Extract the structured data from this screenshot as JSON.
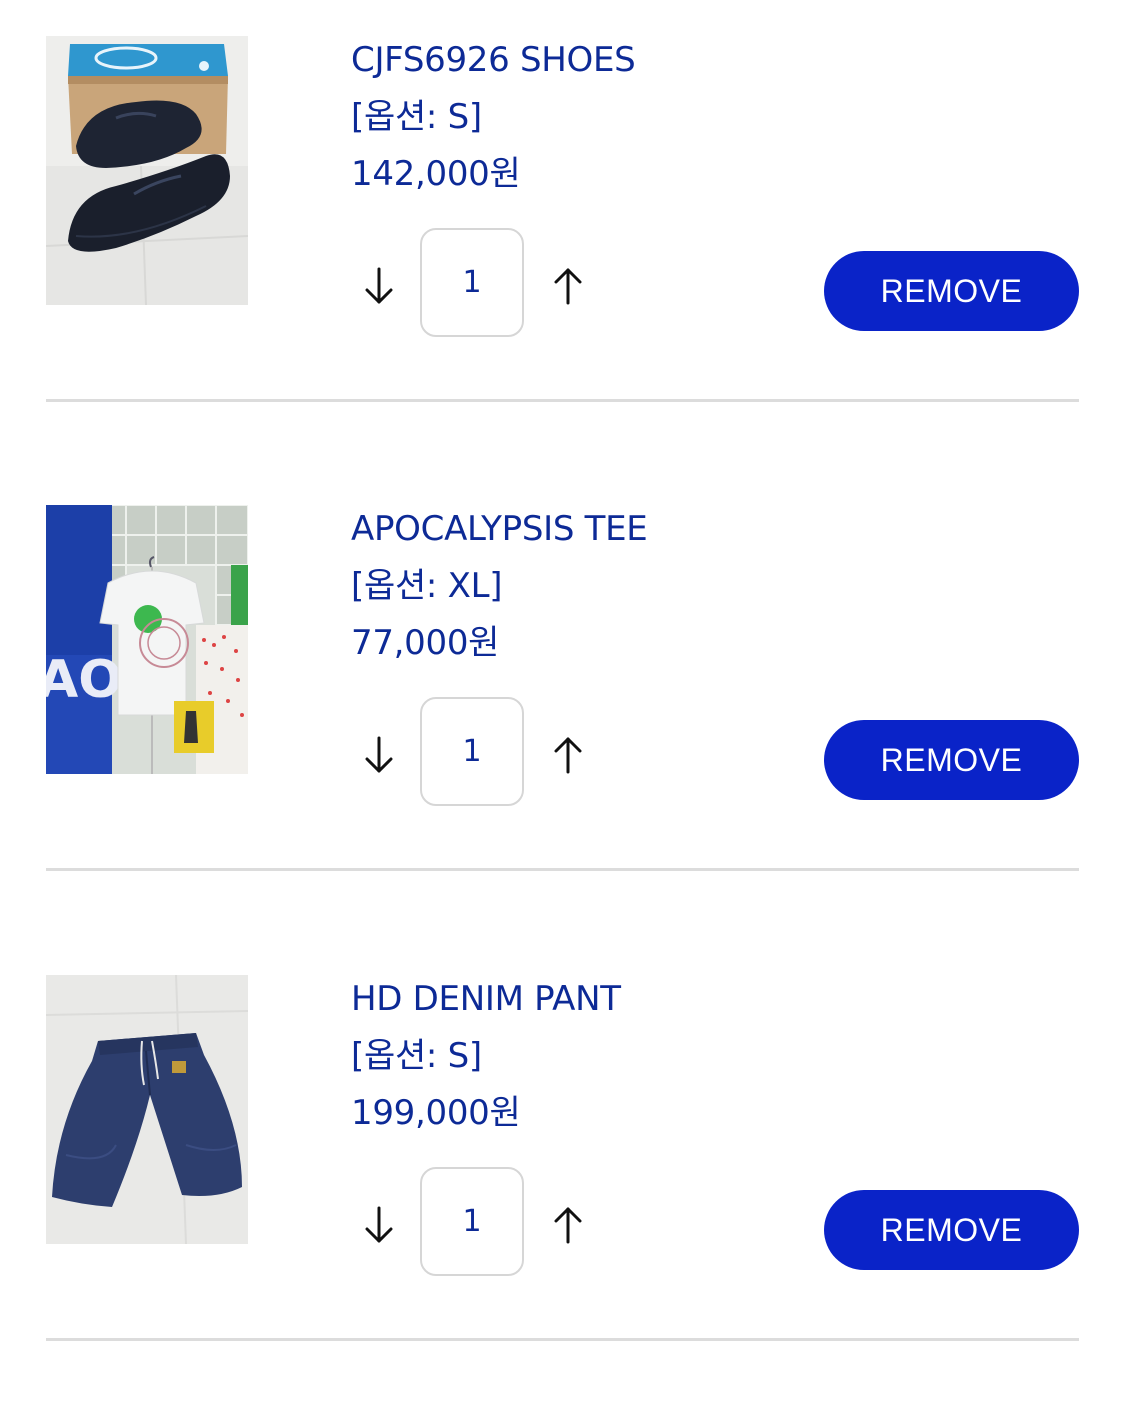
{
  "colors": {
    "accent": "#0a23c8",
    "text": "#0d2a96",
    "arrow": "#111111",
    "divider": "#dcdcdc"
  },
  "icons": {
    "decrease": "arrow-down-icon",
    "increase": "arrow-up-icon"
  },
  "cart": {
    "items": [
      {
        "name": "CJFS6926 SHOES",
        "option": "[옵션: S]",
        "price": "142,000원",
        "quantity": "1",
        "remove_label": "REMOVE"
      },
      {
        "name": "APOCALYPSIS TEE",
        "option": "[옵션: XL]",
        "price": "77,000원",
        "quantity": "1",
        "remove_label": "REMOVE"
      },
      {
        "name": "HD DENIM PANT",
        "option": "[옵션: S]",
        "price": "199,000원",
        "quantity": "1",
        "remove_label": "REMOVE"
      }
    ]
  }
}
